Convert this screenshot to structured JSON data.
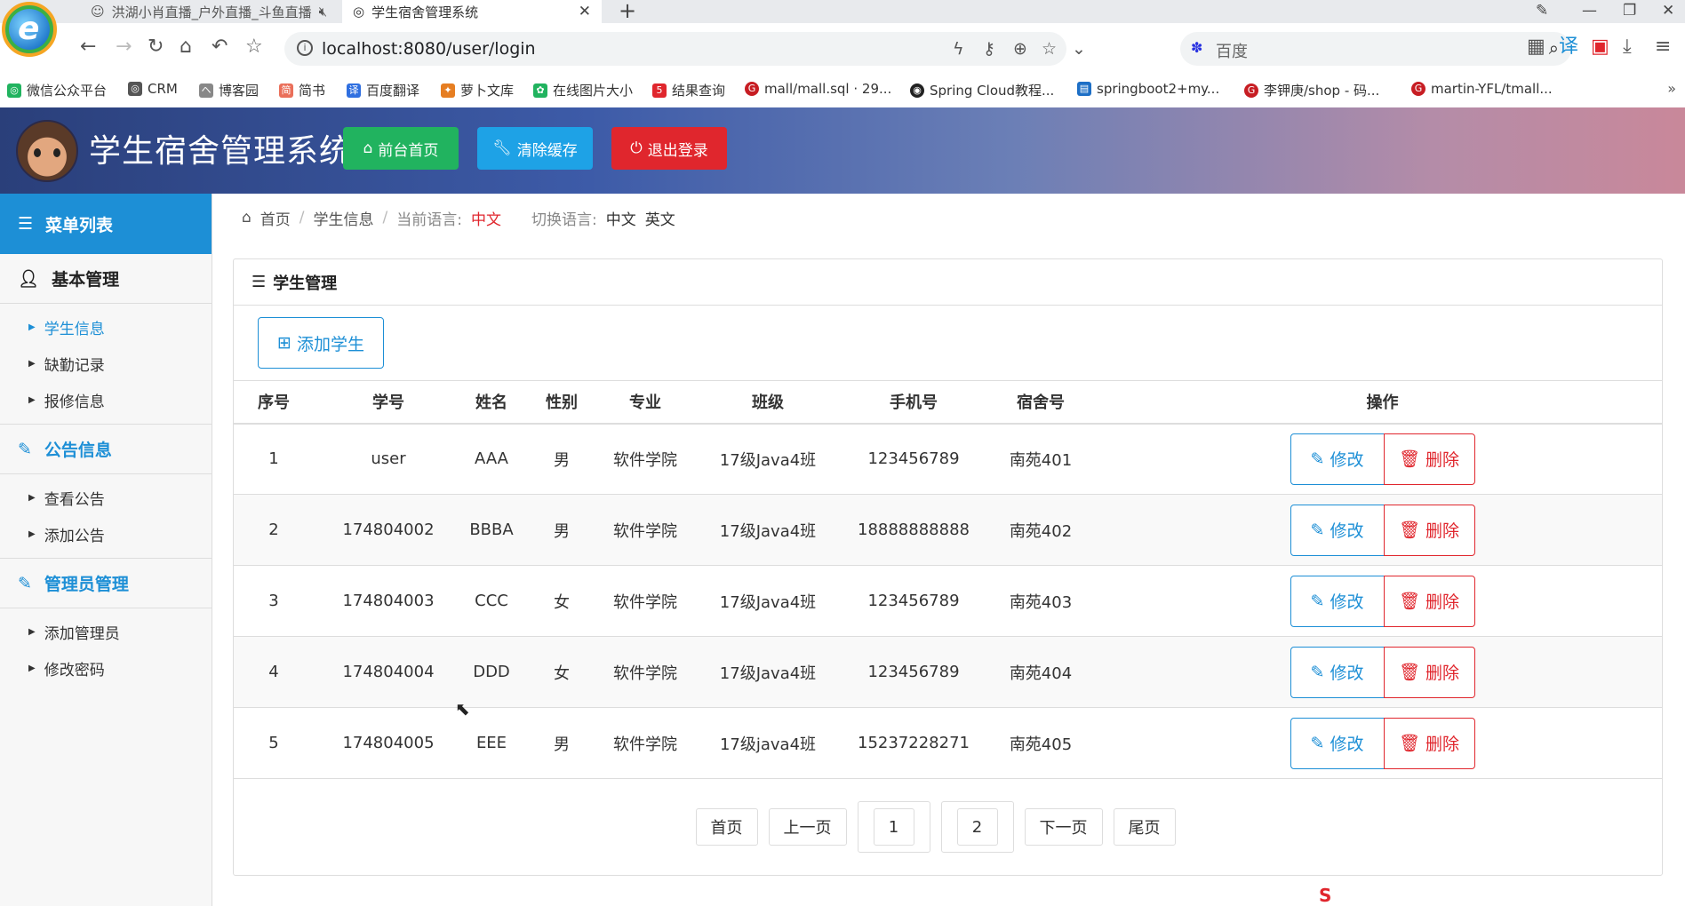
{
  "browser": {
    "tab_inactive": "洪湖小肖直播_户外直播_斗鱼直播",
    "tab_active": "学生宿舍管理系统",
    "url": "localhost:8080/user/login",
    "search_placeholder": "百度",
    "bookmarks": [
      "微信公众平台",
      "CRM",
      "博客园",
      "简书",
      "百度翻译",
      "萝卜文库",
      "在线图片大小",
      "结果查询",
      "mall/mall.sql · 29...",
      "Spring Cloud教程...",
      "springboot2+my...",
      "李钾庚/shop - 码...",
      "martin-YFL/tmall..."
    ]
  },
  "header": {
    "title": "学生宿舍管理系统",
    "btn_home": "前台首页",
    "btn_cache": "清除缓存",
    "btn_logout": "退出登录",
    "colors": {
      "green": "#21b35f",
      "blue": "#1ea2e6",
      "red": "#e0262d"
    }
  },
  "sidebar": {
    "head": "菜单列表",
    "groups": [
      {
        "title": "基本管理",
        "items": [
          "学生信息",
          "缺勤记录",
          "报修信息"
        ]
      },
      {
        "title": "公告信息",
        "items": [
          "查看公告",
          "添加公告"
        ]
      },
      {
        "title": "管理员管理",
        "items": [
          "添加管理员",
          "修改密码"
        ]
      }
    ]
  },
  "breadcrumb": {
    "home": "首页",
    "current": "学生信息",
    "lang_label": "当前语言:",
    "lang_value": "中文",
    "switch_label": "切换语言:",
    "lang_zh": "中文",
    "lang_en": "英文"
  },
  "panel": {
    "title": "学生管理",
    "add_button": "添加学生",
    "columns": [
      "序号",
      "学号",
      "姓名",
      "性别",
      "专业",
      "班级",
      "手机号",
      "宿舍号",
      "操作"
    ],
    "rows": [
      [
        "1",
        "user",
        "AAA",
        "男",
        "软件学院",
        "17级Java4班",
        "123456789",
        "南苑401"
      ],
      [
        "2",
        "174804002",
        "BBBA",
        "男",
        "软件学院",
        "17级Java4班",
        "18888888888",
        "南苑402"
      ],
      [
        "3",
        "174804003",
        "CCC",
        "女",
        "软件学院",
        "17级Java4班",
        "123456789",
        "南苑403"
      ],
      [
        "4",
        "174804004",
        "DDD",
        "女",
        "软件学院",
        "17级Java4班",
        "123456789",
        "南苑404"
      ],
      [
        "5",
        "174804005",
        "EEE",
        "男",
        "软件学院",
        "17级java4班",
        "15237228271",
        "南苑405"
      ]
    ],
    "edit_label": "修改",
    "delete_label": "删除",
    "pager": {
      "first": "首页",
      "prev": "上一页",
      "page1": "1",
      "page2": "2",
      "next": "下一页",
      "last": "尾页"
    }
  }
}
